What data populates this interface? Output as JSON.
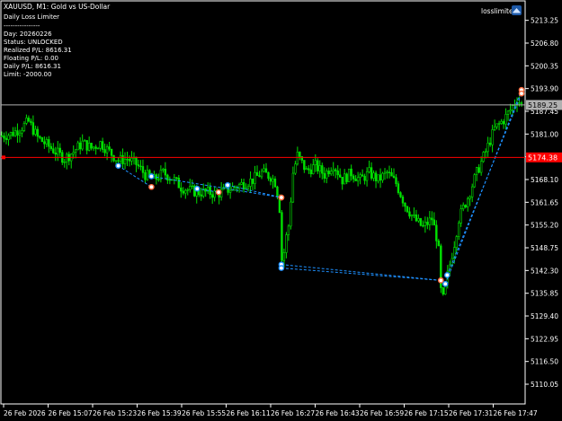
{
  "header": {
    "symbol_line": "XAUUSD, M1:  Gold vs US-Dollar",
    "indicator_name": "Daily Loss Limiter",
    "separator": "----------------",
    "day": "Day: 20260226",
    "status": "Status: UNLOCKED",
    "realized": "Realized P/L: 8616.31",
    "floating": "Floating P/L: 0.00",
    "daily": "Daily P/L: 8616.31",
    "limit": "Limit: -2000.00"
  },
  "expert": {
    "name": "losslimiter",
    "icon": "hat-icon"
  },
  "colors": {
    "background": "#000000",
    "bull_candle": "#00e000",
    "bear_candle": "#00e000",
    "axis": "#ffffff",
    "bid_line": "#b0b0b0",
    "sl_line": "#ff0000",
    "trade_line": "#1e90ff"
  },
  "price_axis": {
    "labels": [
      "5213.25",
      "5206.80",
      "5200.35",
      "5193.90",
      "5187.45",
      "5181.00",
      "5174.55",
      "5168.10",
      "5161.65",
      "5155.20",
      "5148.75",
      "5142.30",
      "5135.85",
      "5129.40",
      "5122.95",
      "5116.50",
      "5110.05"
    ],
    "bid_label": "5189.25",
    "sl_label": "5174.38"
  },
  "time_axis": {
    "labels": [
      "26 Feb 2026",
      "26 Feb 15:07",
      "26 Feb 15:23",
      "26 Feb 15:39",
      "26 Feb 15:55",
      "26 Feb 16:11",
      "26 Feb 16:27",
      "26 Feb 16:43",
      "26 Feb 16:59",
      "26 Feb 17:15",
      "26 Feb 17:31",
      "26 Feb 17:47"
    ]
  },
  "chart_data": {
    "type": "candlestick",
    "symbol": "XAUUSD",
    "timeframe": "M1",
    "ylim": [
      5107,
      5218
    ],
    "close_path": [
      [
        0,
        5180.5
      ],
      [
        10,
        5181.0
      ],
      [
        20,
        5182.5
      ],
      [
        30,
        5184.5
      ],
      [
        40,
        5180.0
      ],
      [
        50,
        5178.0
      ],
      [
        60,
        5176.0
      ],
      [
        70,
        5174.0
      ],
      [
        80,
        5176.0
      ],
      [
        90,
        5178.5
      ],
      [
        100,
        5177.0
      ],
      [
        110,
        5178.5
      ],
      [
        120,
        5176.0
      ],
      [
        130,
        5173.5
      ],
      [
        140,
        5174.0
      ],
      [
        150,
        5172.5
      ],
      [
        160,
        5169.5
      ],
      [
        170,
        5168.0
      ],
      [
        180,
        5170.0
      ],
      [
        190,
        5168.5
      ],
      [
        200,
        5166.0
      ],
      [
        210,
        5165.0
      ],
      [
        220,
        5164.5
      ],
      [
        230,
        5164.5
      ],
      [
        240,
        5164.0
      ],
      [
        250,
        5165.0
      ],
      [
        260,
        5166.0
      ],
      [
        270,
        5167.0
      ],
      [
        280,
        5168.0
      ],
      [
        290,
        5170.0
      ],
      [
        300,
        5169.0
      ],
      [
        306,
        5167.0
      ],
      [
        310,
        5160.0
      ],
      [
        313,
        5142.5
      ],
      [
        316,
        5150.0
      ],
      [
        320,
        5155.0
      ],
      [
        325,
        5170.0
      ],
      [
        330,
        5175.0
      ],
      [
        340,
        5170.5
      ],
      [
        350,
        5172.0
      ],
      [
        360,
        5169.5
      ],
      [
        370,
        5172.5
      ],
      [
        380,
        5168.0
      ],
      [
        390,
        5170.0
      ],
      [
        400,
        5168.0
      ],
      [
        410,
        5170.0
      ],
      [
        420,
        5168.0
      ],
      [
        430,
        5170.0
      ],
      [
        440,
        5167.0
      ],
      [
        450,
        5161.0
      ],
      [
        460,
        5157.0
      ],
      [
        470,
        5154.5
      ],
      [
        480,
        5157.0
      ],
      [
        487,
        5150.0
      ],
      [
        491,
        5132.0
      ],
      [
        495,
        5138.0
      ],
      [
        500,
        5144.0
      ],
      [
        505,
        5150.0
      ],
      [
        510,
        5157.0
      ],
      [
        520,
        5163.0
      ],
      [
        530,
        5170.0
      ],
      [
        540,
        5176.0
      ],
      [
        550,
        5182.5
      ],
      [
        560,
        5185.0
      ],
      [
        568,
        5188.0
      ],
      [
        575,
        5191.0
      ],
      [
        580,
        5189.3
      ]
    ],
    "sl_level": 5174.38,
    "bid": 5189.25,
    "trades": [
      {
        "from": [
          130,
          5172.0
        ],
        "to": [
          167,
          5166.0
        ]
      },
      {
        "from": [
          167,
          5169.0
        ],
        "to": [
          312,
          5163.0
        ]
      },
      {
        "from": [
          218,
          5165.5
        ],
        "to": [
          242,
          5164.5
        ]
      },
      {
        "from": [
          252,
          5166.5
        ],
        "to": [
          312,
          5163.0
        ]
      },
      {
        "from": [
          312,
          5144.0
        ],
        "to": [
          490,
          5139.5
        ]
      },
      {
        "from": [
          312,
          5143.0
        ],
        "to": [
          490,
          5139.5
        ]
      },
      {
        "from": [
          495,
          5138.5
        ],
        "to": [
          580,
          5193.5
        ]
      },
      {
        "from": [
          497,
          5141.0
        ],
        "to": [
          580,
          5192.5
        ]
      }
    ]
  }
}
